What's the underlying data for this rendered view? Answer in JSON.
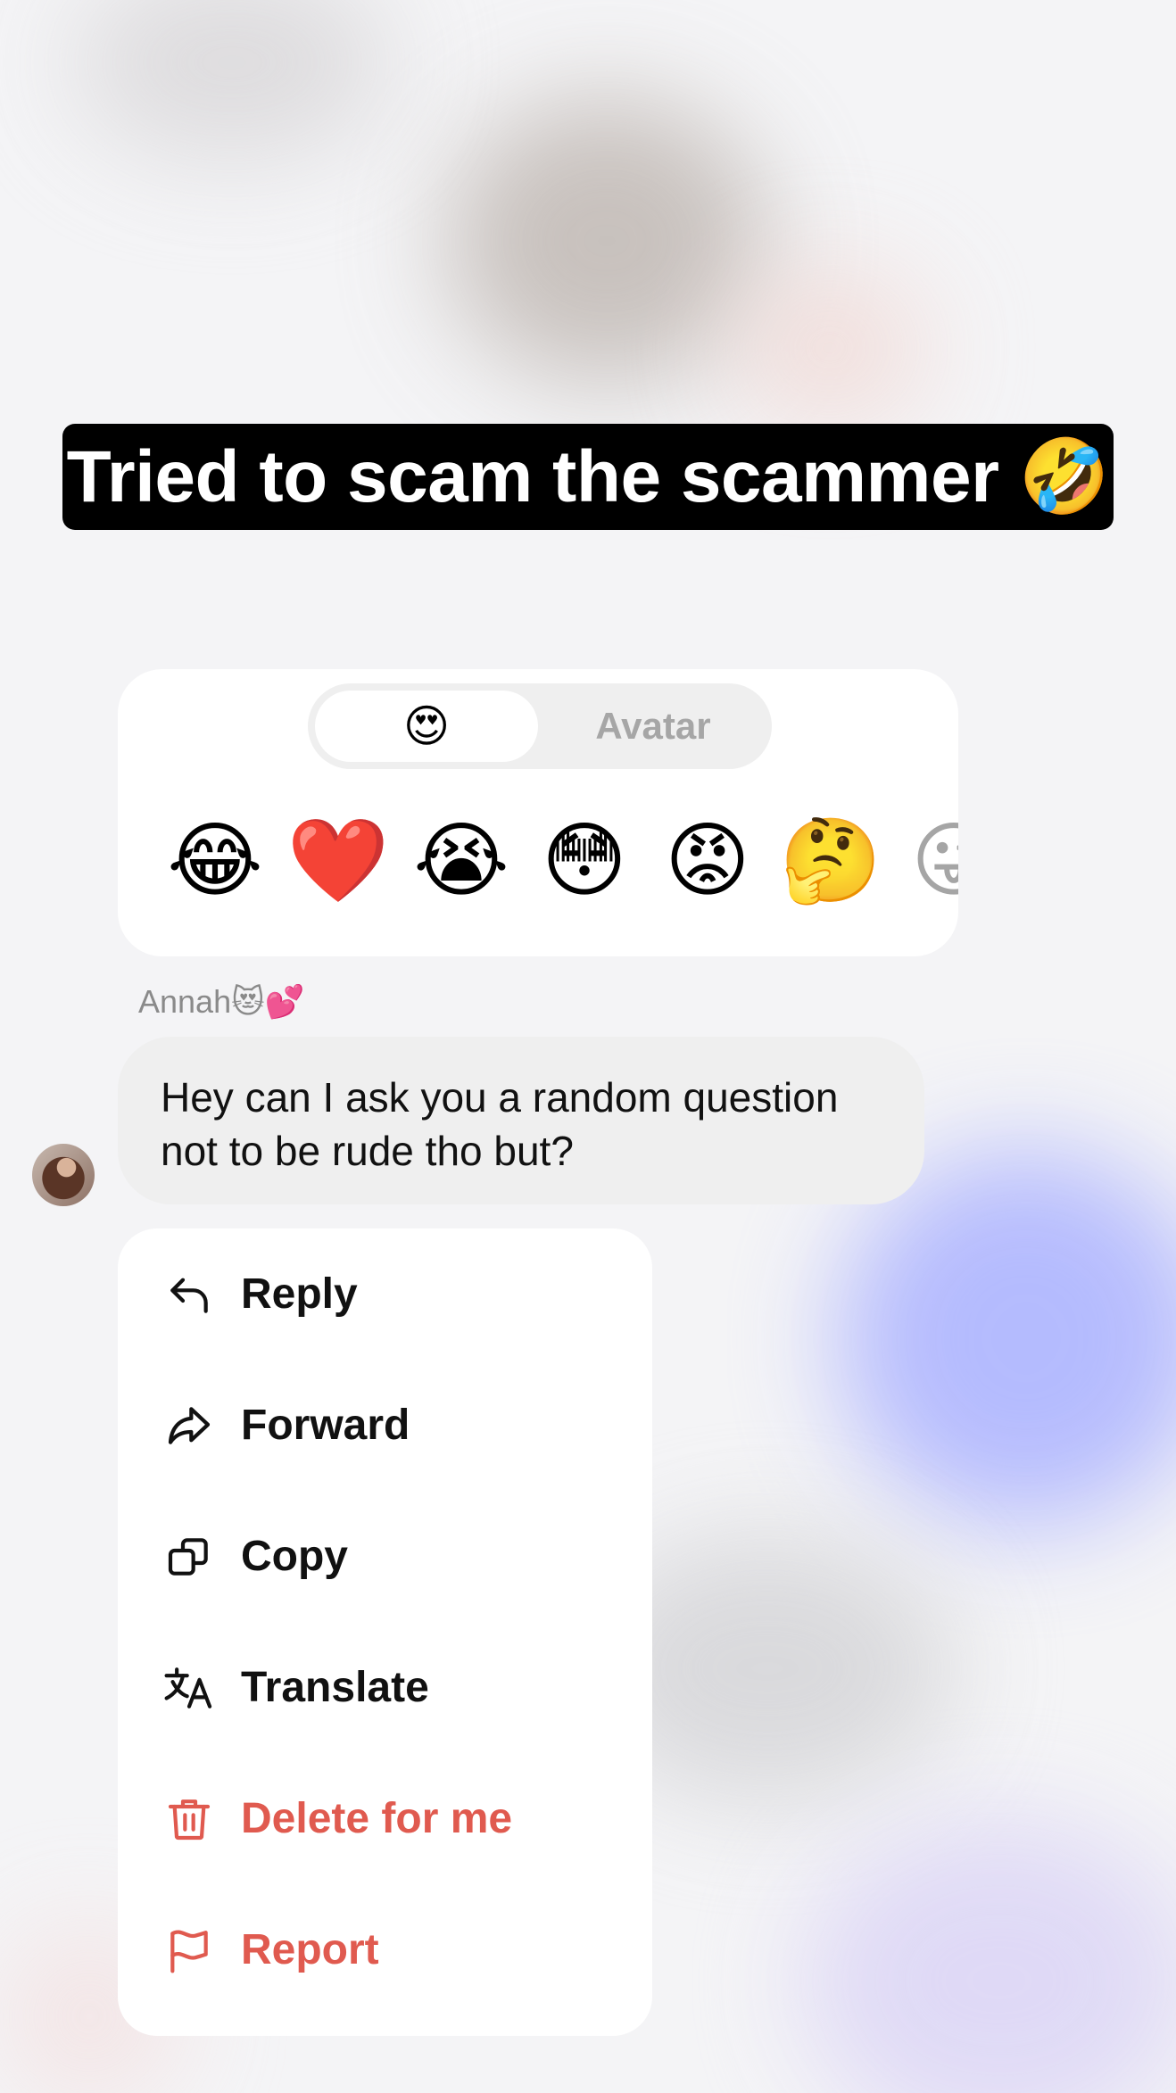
{
  "caption": {
    "text": "Tried to scam the scammer 🤣"
  },
  "reaction_picker": {
    "tabs": [
      {
        "label": "😍",
        "selected": true
      },
      {
        "label": "Avatar",
        "selected": false
      }
    ],
    "emojis": [
      "😂",
      "❤️",
      "😭",
      "😳",
      "😡",
      "🤔",
      "😜"
    ]
  },
  "message": {
    "sender": "Annah😻💕",
    "text": "Hey can I ask you a random question not to be rude tho but?"
  },
  "context_menu": {
    "items": [
      {
        "label": "Reply",
        "icon": "reply-icon",
        "destructive": false
      },
      {
        "label": "Forward",
        "icon": "forward-icon",
        "destructive": false
      },
      {
        "label": "Copy",
        "icon": "copy-icon",
        "destructive": false
      },
      {
        "label": "Translate",
        "icon": "translate-icon",
        "destructive": false
      },
      {
        "label": "Delete for me",
        "icon": "trash-icon",
        "destructive": true
      },
      {
        "label": "Report",
        "icon": "flag-icon",
        "destructive": true
      }
    ]
  },
  "colors": {
    "destructive": "#e05a4f",
    "caption_bg": "#000000",
    "bubble_bg": "#efefef"
  }
}
